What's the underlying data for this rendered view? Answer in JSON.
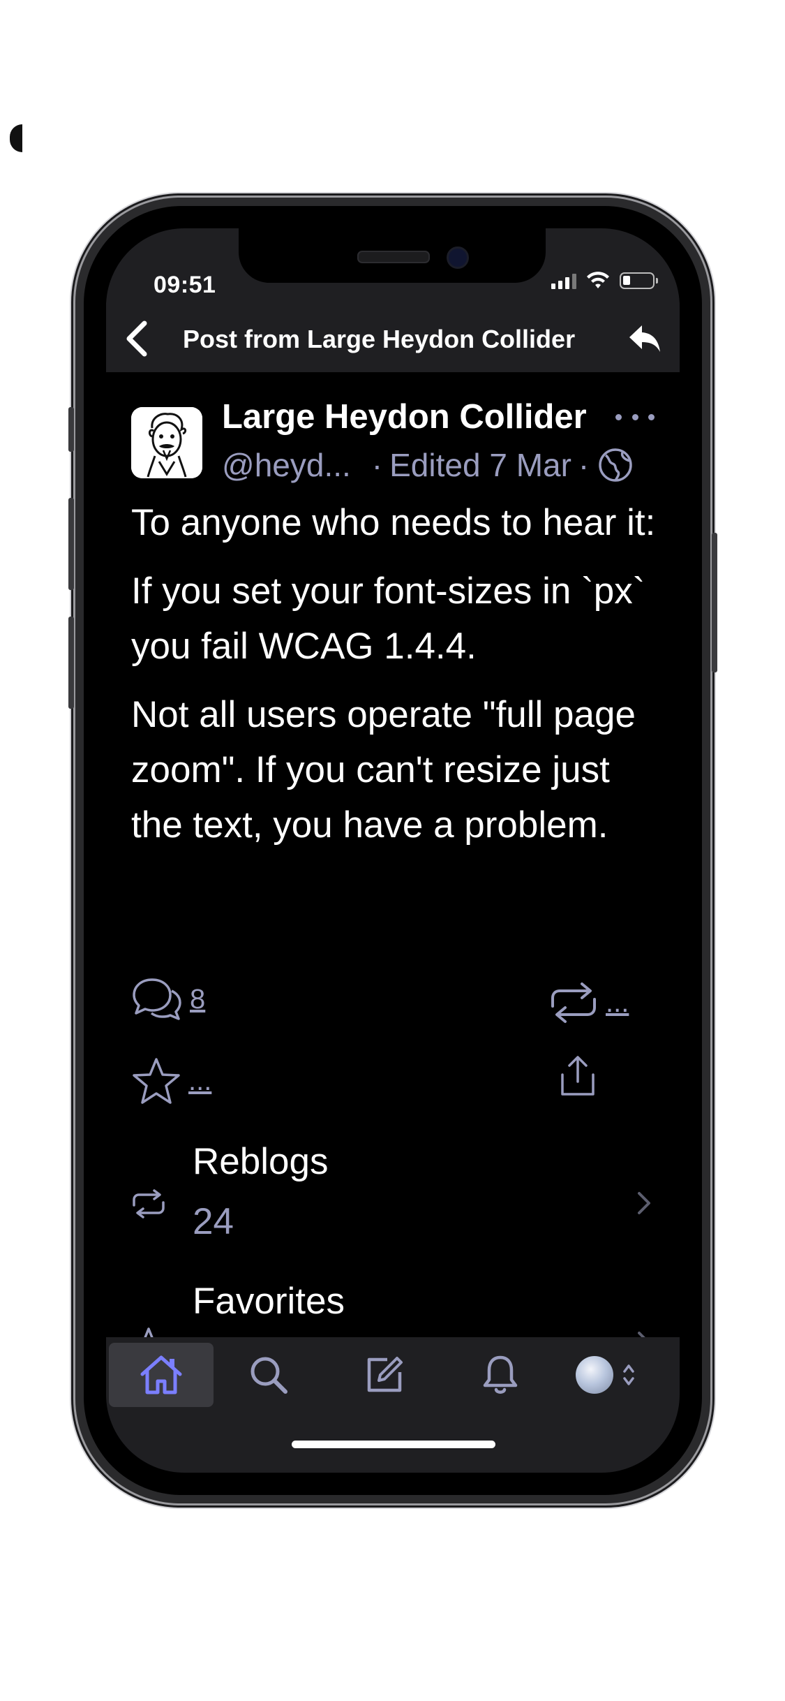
{
  "status_bar": {
    "time": "09:51",
    "icons": [
      "signal-icon",
      "wifi-icon",
      "battery-icon"
    ]
  },
  "nav": {
    "title": "Post from Large Heydon Collider",
    "back_icon": "chevron-left-icon",
    "reply_icon": "reply-icon"
  },
  "post": {
    "author_name": "Large Heydon Collider",
    "handle": "@heyd...",
    "separator": "·",
    "edited": "Edited 7 Mar",
    "separator2": "·",
    "visibility_icon": "globe-icon",
    "paragraphs": [
      "To anyone who needs to hear it:",
      "If you set your font-sizes in `px` you fail WCAG 1.4.4.",
      "Not all users operate \"full page zoom\". If you can't resize just the text, you have a problem."
    ]
  },
  "actions": {
    "replies_count": "8",
    "reblog_count": "...",
    "favorite_count": "...",
    "icons": [
      "comments-icon",
      "reblog-icon",
      "star-icon",
      "share-icon"
    ]
  },
  "stats": [
    {
      "label": "Reblogs",
      "value": "24",
      "icon": "reblog-icon"
    },
    {
      "label": "Favorites",
      "value": "",
      "icon": "star-icon"
    }
  ],
  "tabbar": {
    "tabs": [
      "home",
      "search",
      "compose",
      "notifications",
      "profile"
    ],
    "active": "home"
  },
  "colors": {
    "accent": "#7b7fff",
    "muted": "#9a9dbf",
    "bar_bg": "#1f1f22",
    "background": "#000000"
  }
}
